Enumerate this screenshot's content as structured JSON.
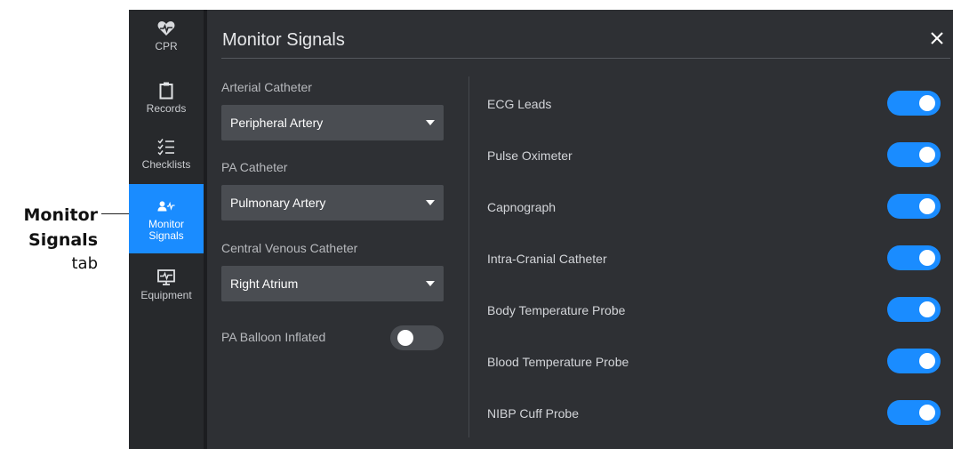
{
  "callout": {
    "line1": "Monitor",
    "line2": "Signals",
    "line3": "tab"
  },
  "sidebar": {
    "items": [
      {
        "label": "CPR",
        "icon": "heart-pulse-icon",
        "active": false
      },
      {
        "label": "Records",
        "icon": "clipboard-icon",
        "active": false
      },
      {
        "label": "Checklists",
        "icon": "checklist-icon",
        "active": false
      },
      {
        "label": "Monitor Signals",
        "icon": "person-pulse-icon",
        "active": true
      },
      {
        "label": "Equipment",
        "icon": "monitor-icon",
        "active": false
      }
    ]
  },
  "panel": {
    "title": "Monitor Signals",
    "close_icon": "close-icon"
  },
  "catheters": [
    {
      "label": "Arterial Catheter",
      "value": "Peripheral Artery"
    },
    {
      "label": "PA Catheter",
      "value": "Pulmonary Artery"
    },
    {
      "label": "Central Venous Catheter",
      "value": "Right Atrium"
    }
  ],
  "balloon": {
    "label": "PA Balloon Inflated",
    "on": false
  },
  "signals": [
    {
      "label": "ECG Leads",
      "on": true
    },
    {
      "label": "Pulse Oximeter",
      "on": true
    },
    {
      "label": "Capnograph",
      "on": true
    },
    {
      "label": "Intra-Cranial Catheter",
      "on": true
    },
    {
      "label": "Body Temperature Probe",
      "on": true
    },
    {
      "label": "Blood Temperature Probe",
      "on": true
    },
    {
      "label": "NIBP Cuff Probe",
      "on": true
    }
  ],
  "colors": {
    "accent": "#1a8cff",
    "panel_bg": "#2e3034",
    "sidebar_bg": "#27292c",
    "select_bg": "#4a4d52"
  }
}
